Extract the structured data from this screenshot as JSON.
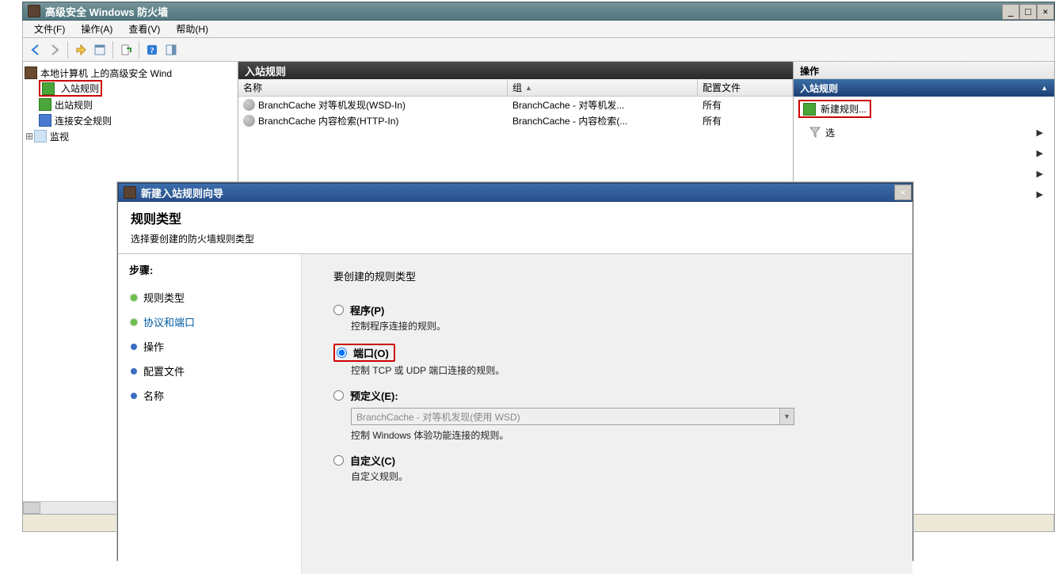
{
  "window": {
    "title": "高级安全 Windows 防火墙"
  },
  "menu": {
    "file": "文件(F)",
    "action": "操作(A)",
    "view": "查看(V)",
    "help": "帮助(H)"
  },
  "tree": {
    "root": "本地计算机 上的高级安全 Wind",
    "inbound": "入站规则",
    "outbound": "出站规则",
    "connsec": "连接安全规则",
    "monitor": "监视"
  },
  "center": {
    "title": "入站规则",
    "columns": {
      "name": "名称",
      "group": "组",
      "profile": "配置文件"
    },
    "rows": [
      {
        "name": "BranchCache 对等机发现(WSD-In)",
        "group": "BranchCache - 对等机发...",
        "profile": "所有"
      },
      {
        "name": "BranchCache 内容检索(HTTP-In)",
        "group": "BranchCache - 内容检索(...",
        "profile": "所有"
      }
    ]
  },
  "actions": {
    "title": "操作",
    "section": "入站规则",
    "new_rule": "新建规则...",
    "filter_prof": "选"
  },
  "wizard": {
    "title": "新建入站规则向导",
    "heading": "规则类型",
    "subheading": "选择要创建的防火墙规则类型",
    "steps_label": "步骤:",
    "steps": {
      "type": "规则类型",
      "protocol": "协议和端口",
      "action": "操作",
      "profile": "配置文件",
      "name": "名称"
    },
    "prompt": "要创建的规则类型",
    "opts": {
      "program": {
        "label": "程序(P)",
        "desc": "控制程序连接的规则。"
      },
      "port": {
        "label": "端口(O)",
        "desc": "控制 TCP 或 UDP 端口连接的规则。"
      },
      "predef": {
        "label": "预定义(E):",
        "combo": "BranchCache - 对等机发现(使用 WSD)",
        "desc": "控制 Windows 体验功能连接的规则。"
      },
      "custom": {
        "label": "自定义(C)",
        "desc": "自定义规则。"
      }
    }
  }
}
